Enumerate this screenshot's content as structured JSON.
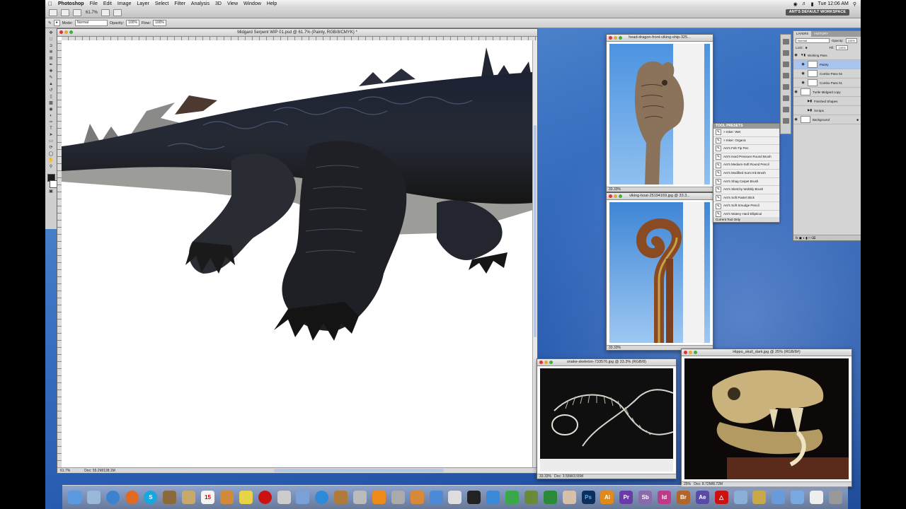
{
  "menubar": {
    "app": "Photoshop",
    "items": [
      "File",
      "Edit",
      "Image",
      "Layer",
      "Select",
      "Filter",
      "Analysis",
      "3D",
      "View",
      "Window",
      "Help"
    ],
    "clock": "Tue 12:06 AM"
  },
  "appbar": {
    "zoom": "61.7%",
    "workspace": "ANT'S DEFAULT WORKSPACE"
  },
  "options": {
    "mode_label": "Mode:",
    "mode": "Normal",
    "opacity_label": "Opacity:",
    "opacity": "100%",
    "flow_label": "Flow:",
    "flow": "100%"
  },
  "document": {
    "title": "Midgard Serpent WIP 01.psd @ 61.7% (Painty, RGB/8/CMYK) *",
    "zoom": "61.7%",
    "doc_size": "Doc: 55.2M/138.1M"
  },
  "windows": {
    "dragon": {
      "title": "head-dragon-front-viking-ship-325...",
      "zoom": "33.33%"
    },
    "boat": {
      "title": "viking-boat-25194169.jpg @ 33.3...",
      "zoom": "33.33%"
    },
    "snake": {
      "title": "snake-skeleton-733576.jpg @ 33.3% (RGB/8)",
      "zoom": "33.33%",
      "doc": "Doc: 3.55M/3.55M"
    },
    "hippo": {
      "title": "Hippo_skull_dark.jpg @ 25% (RGB/8#)",
      "zoom": "25%",
      "doc": "Doc: 8.72M/8.72M"
    }
  },
  "presets": {
    "title": "TOOL PRESETS",
    "items": [
      "> Inker: Wet",
      "> Inker: Organic",
      "Ant's Felt-Tip Pen",
      "Ant's Hard Pressure Round Brush",
      "Ant's Medium-Soft Round Pencil",
      "Ant's Modified Sumi Ink Brush",
      "Ant's Shag Carpet Brush",
      "Ant's Sketchy Wobbly Brush",
      "Ant's Soft Pastel Stick",
      "Ant's Soft Smudge Pencil",
      "Ant's Watery Hard Elliptical"
    ],
    "footer": "Current Tool Only"
  },
  "layers": {
    "tabs": [
      "LAYERS",
      "HISTORY"
    ],
    "blend": "Normal",
    "opacity_label": "Opacity:",
    "opacity": "100%",
    "lock_label": "Lock:",
    "fill_label": "Fill:",
    "fill": "100%",
    "rows": [
      {
        "name": "Working Pass",
        "kind": "group"
      },
      {
        "name": "Painty",
        "kind": "layer",
        "selected": true
      },
      {
        "name": "Combo Pass 02",
        "kind": "layer"
      },
      {
        "name": "Combo Pass 01",
        "kind": "layer"
      },
      {
        "name": "Turtle Midgard copy",
        "kind": "top"
      },
      {
        "name": "Finished Shapes",
        "kind": "group"
      },
      {
        "name": "Scraps",
        "kind": "group"
      },
      {
        "name": "Background",
        "kind": "top"
      }
    ],
    "bottom": "fx"
  },
  "colors": {
    "foreground": "#1c1c1c",
    "background": "#ffffff",
    "selection": "#a9c4ee",
    "desktop": "#2a5eb3"
  },
  "dock": {
    "icons": [
      "finder",
      "preview",
      "safari",
      "firefox",
      "skype",
      "eagle",
      "notes",
      "calendar",
      "photo",
      "stickies",
      "record",
      "script",
      "ical",
      "itunes",
      "guitar",
      "compass",
      "vlc",
      "hdd",
      "mail",
      "itunes2",
      "pdf",
      "ichat",
      "dropbox",
      "drive",
      "growl",
      "apple",
      "hand",
      "ps",
      "ai",
      "pr",
      "sb",
      "id",
      "br",
      "ae",
      "acrobat",
      "folder",
      "docs",
      "apps",
      "downloads",
      "documents",
      "trash"
    ],
    "labels": {
      "ps": "Ps",
      "ai": "Ai",
      "pr": "Pr",
      "sb": "Sb",
      "id": "Id",
      "br": "Br",
      "ae": "Ae",
      "calendar": "15"
    }
  }
}
